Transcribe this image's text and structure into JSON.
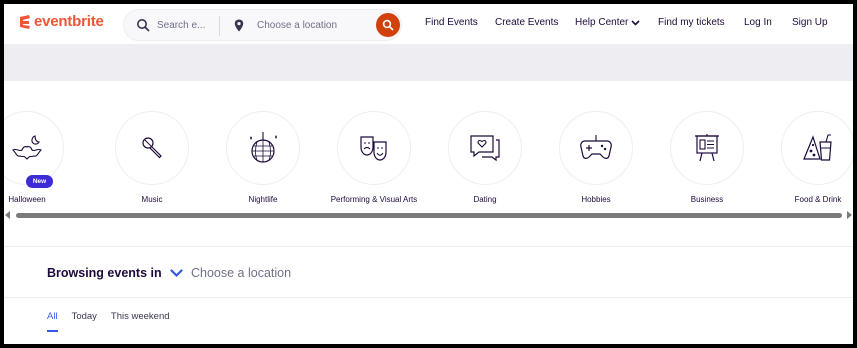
{
  "brand": {
    "name": "eventbrite",
    "color": "#f05537"
  },
  "search": {
    "placeholder": "Search e...",
    "location_placeholder": "Choose a location"
  },
  "nav": {
    "find_events": "Find Events",
    "create_events": "Create Events",
    "help_center": "Help Center",
    "find_tickets": "Find my tickets",
    "login": "Log In",
    "signup": "Sign Up"
  },
  "categories": [
    {
      "label": "Halloween",
      "icon": "bat-icon",
      "badge": "New"
    },
    {
      "label": "Music",
      "icon": "microphone-icon"
    },
    {
      "label": "Nightlife",
      "icon": "disco-ball-icon"
    },
    {
      "label": "Performing & Visual Arts",
      "icon": "theater-masks-icon"
    },
    {
      "label": "Dating",
      "icon": "chat-heart-icon"
    },
    {
      "label": "Hobbies",
      "icon": "gamepad-icon"
    },
    {
      "label": "Business",
      "icon": "presentation-icon"
    },
    {
      "label": "Food & Drink",
      "icon": "pizza-drink-icon"
    }
  ],
  "browsing": {
    "title": "Browsing events in",
    "location": "Choose a location"
  },
  "tabs": [
    {
      "label": "All",
      "active": true
    },
    {
      "label": "Today",
      "active": false
    },
    {
      "label": "This weekend",
      "active": false
    }
  ],
  "colors": {
    "accent_blue": "#3659e3",
    "search_button": "#d1410c",
    "badge": "#3d2ad8"
  }
}
